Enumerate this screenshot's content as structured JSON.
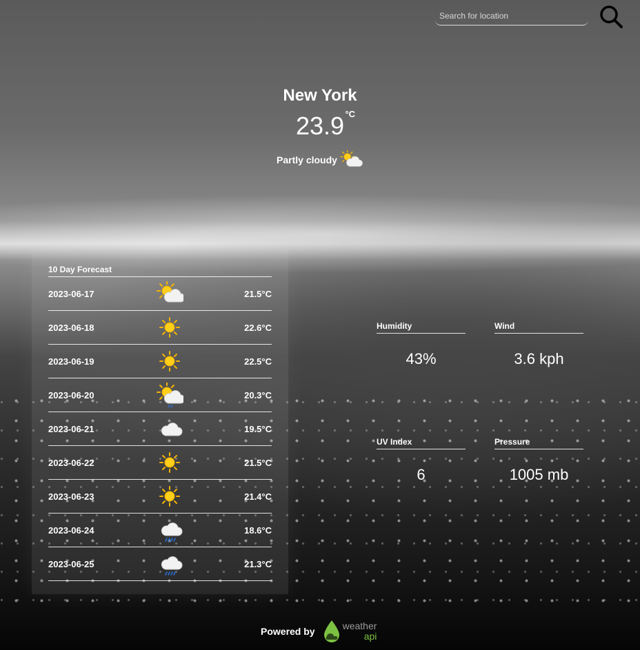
{
  "search": {
    "placeholder": "Search for location"
  },
  "current": {
    "city": "New York",
    "temperature": "23.9",
    "unit": "°C",
    "condition": "Partly cloudy",
    "condition_icon": "partly-cloudy-icon"
  },
  "forecast": {
    "title": "10 Day Forecast",
    "days": [
      {
        "date": "2023-06-17",
        "icon": "partly-cloudy-icon",
        "temp": "21.5°C"
      },
      {
        "date": "2023-06-18",
        "icon": "sunny-icon",
        "temp": "22.6°C"
      },
      {
        "date": "2023-06-19",
        "icon": "sunny-icon",
        "temp": "22.5°C"
      },
      {
        "date": "2023-06-20",
        "icon": "patchy-rain-icon",
        "temp": "20.3°C"
      },
      {
        "date": "2023-06-21",
        "icon": "cloudy-icon",
        "temp": "19.5°C"
      },
      {
        "date": "2023-06-22",
        "icon": "sunny-icon",
        "temp": "21.5°C"
      },
      {
        "date": "2023-06-23",
        "icon": "sunny-icon",
        "temp": "21.4°C"
      },
      {
        "date": "2023-06-24",
        "icon": "rain-cloud-icon",
        "temp": "18.6°C"
      },
      {
        "date": "2023-06-25",
        "icon": "rain-cloud-icon",
        "temp": "21.3°C"
      }
    ]
  },
  "stats": {
    "humidity": {
      "label": "Humidity",
      "value": "43%"
    },
    "wind": {
      "label": "Wind",
      "value": "3.6 kph"
    },
    "uv": {
      "label": "UV Index",
      "value": "6"
    },
    "pressure": {
      "label": "Pressure",
      "value": "1005 mb"
    }
  },
  "footer": {
    "powered_by": "Powered by",
    "logo_word1": "weather",
    "logo_word2": "api"
  },
  "colors": {
    "logo_green": "#7cc242",
    "logo_gray": "#9a9a9a",
    "sun": "#f7b500",
    "cloud": "#f2f2f2",
    "rain": "#2a6fd6"
  }
}
